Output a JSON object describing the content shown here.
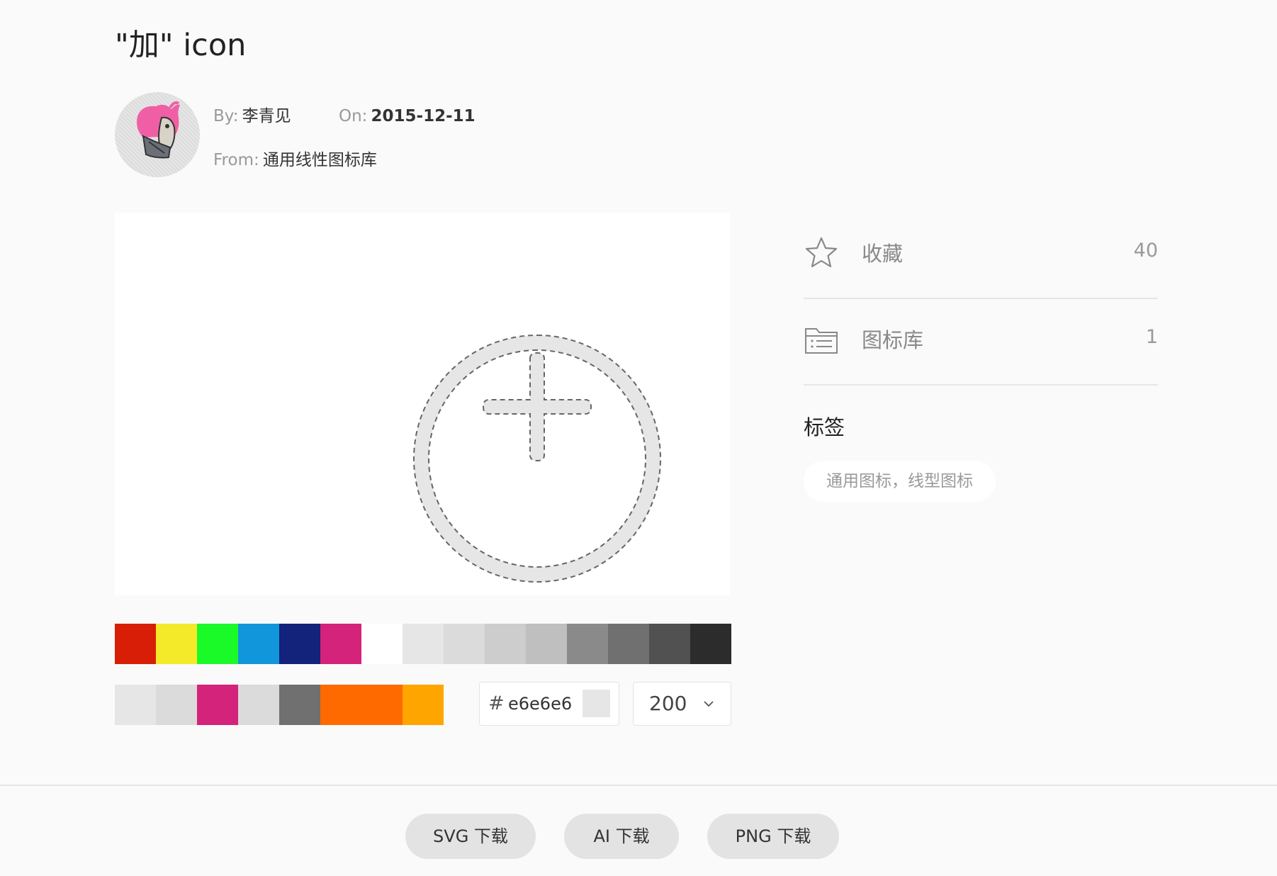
{
  "title": "\"加\" icon",
  "author": {
    "by_label": "By:",
    "by_value": "李青见",
    "on_label": "On:",
    "on_value": "2015-12-11",
    "from_label": "From:",
    "from_value": "通用线性图标库"
  },
  "palette": {
    "row1": [
      "#d81e06",
      "#f4ea2a",
      "#1afa29",
      "#1296db",
      "#13227a",
      "#d4237a",
      "#ffffff",
      "#e6e6e6",
      "#dbdbdb",
      "#cdcdcd",
      "#bfbfbf",
      "#8a8a8a",
      "#707070",
      "#515151",
      "#2c2c2c"
    ],
    "row2": [
      "#e6e6e6",
      "#dbdbdb",
      "#d4237a",
      "#dbdbdb",
      "#707070",
      "#ff6a00",
      "#ff6a00",
      "#ffa500"
    ]
  },
  "color_input": {
    "hash": "#",
    "value": "e6e6e6",
    "preview_color": "#e6e6e6"
  },
  "size_select": {
    "value": "200"
  },
  "stats": {
    "favorites_label": "收藏",
    "favorites_count": "40",
    "library_label": "图标库",
    "library_count": "1"
  },
  "tags": {
    "heading": "标签",
    "items": "通用图标，线型图标"
  },
  "downloads": {
    "svg": "SVG 下载",
    "ai": "AI 下载",
    "png": "PNG 下载"
  },
  "icon_fill": "#e6e6e6",
  "icon_stroke": "#666666"
}
